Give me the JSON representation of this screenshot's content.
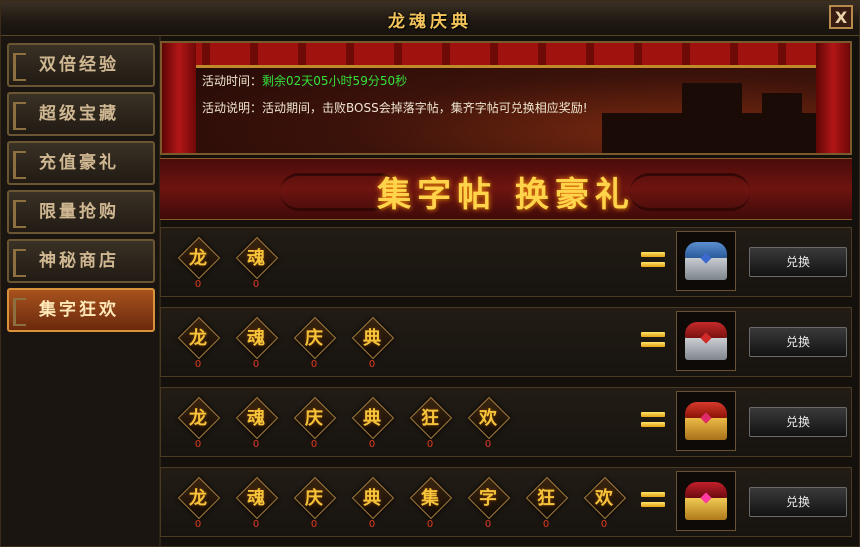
{
  "window": {
    "title": "龙魂庆典",
    "close_label": "X"
  },
  "sidebar": {
    "tabs": [
      {
        "label": "双倍经验",
        "active": false
      },
      {
        "label": "超级宝藏",
        "active": false
      },
      {
        "label": "充值豪礼",
        "active": false
      },
      {
        "label": "限量抢购",
        "active": false
      },
      {
        "label": "神秘商店",
        "active": false
      },
      {
        "label": "集字狂欢",
        "active": true
      }
    ]
  },
  "banner": {
    "time_label": "活动时间：",
    "time_value": "剩余02天05小时59分50秒",
    "desc_label": "活动说明：",
    "desc_value": "活动期间，击败BOSS会掉落字帖，集齐字帖可兑换相应奖励!",
    "slogan": "集字帖 换豪礼"
  },
  "rows": [
    {
      "chars": [
        {
          "c": "龙",
          "n": "0"
        },
        {
          "c": "魂",
          "n": "0"
        }
      ],
      "reward": "silver-blue-chest-icon",
      "button": "兑换"
    },
    {
      "chars": [
        {
          "c": "龙",
          "n": "0"
        },
        {
          "c": "魂",
          "n": "0"
        },
        {
          "c": "庆",
          "n": "0"
        },
        {
          "c": "典",
          "n": "0"
        }
      ],
      "reward": "silver-red-chest-icon",
      "button": "兑换"
    },
    {
      "chars": [
        {
          "c": "龙",
          "n": "0"
        },
        {
          "c": "魂",
          "n": "0"
        },
        {
          "c": "庆",
          "n": "0"
        },
        {
          "c": "典",
          "n": "0"
        },
        {
          "c": "狂",
          "n": "0"
        },
        {
          "c": "欢",
          "n": "0"
        }
      ],
      "reward": "gold-red-chest-icon",
      "button": "兑换"
    },
    {
      "chars": [
        {
          "c": "龙",
          "n": "0"
        },
        {
          "c": "魂",
          "n": "0"
        },
        {
          "c": "庆",
          "n": "0"
        },
        {
          "c": "典",
          "n": "0"
        },
        {
          "c": "集",
          "n": "0"
        },
        {
          "c": "字",
          "n": "0"
        },
        {
          "c": "狂",
          "n": "0"
        },
        {
          "c": "欢",
          "n": "0"
        }
      ],
      "reward": "gold-jeweled-chest-icon",
      "button": "兑换"
    }
  ],
  "colors": {
    "accent": "#f6c43a",
    "count": "#e23a22",
    "timer": "#33e23a",
    "tab_active": "#a8521e"
  }
}
